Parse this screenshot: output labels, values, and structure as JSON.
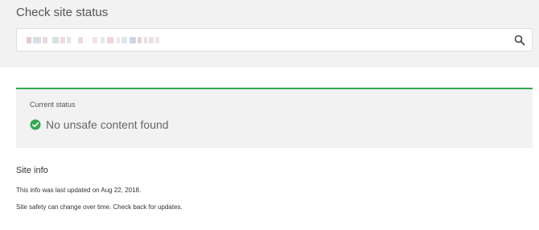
{
  "header": {
    "title": "Check site status"
  },
  "search": {
    "value": "",
    "placeholder": "",
    "icon": "search-icon"
  },
  "status": {
    "label": "Current status",
    "icon": "check-circle-icon",
    "text": "No unsafe content found",
    "accent_color": "#35a853"
  },
  "site_info": {
    "title": "Site info",
    "updated_line": "This info was last updated on Aug 22, 2018.",
    "safety_line": "Site safety can change over time. Check back for updates."
  }
}
